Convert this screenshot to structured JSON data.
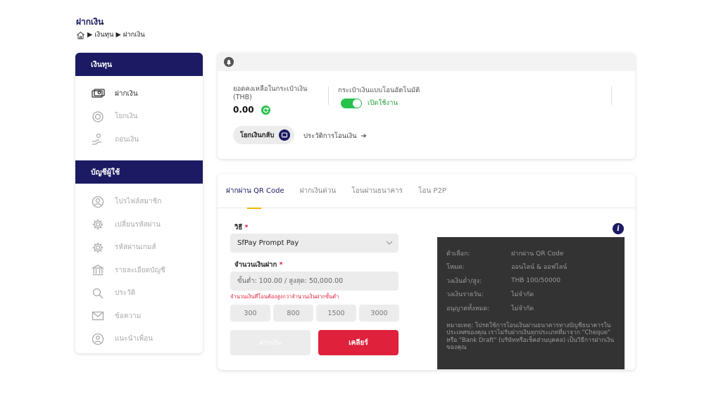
{
  "page": {
    "title": "ฝากเงิน",
    "breadcrumb": [
      "เงินทุน",
      "ฝากเงิน"
    ]
  },
  "sidebar": {
    "section1_title": "เงินทุน",
    "section1_items": [
      {
        "label": "ฝากเงิน",
        "icon": "deposit-icon",
        "active": true
      },
      {
        "label": "โยกเงิน",
        "icon": "transfer-icon",
        "active": false
      },
      {
        "label": "ถอนเงิน",
        "icon": "withdraw-icon",
        "active": false
      }
    ],
    "section2_title": "บัญชีผู้ใช้",
    "section2_items": [
      {
        "label": "โปรไฟล์สมาชิก",
        "icon": "user-icon"
      },
      {
        "label": "เปลี่ยนรหัสผ่าน",
        "icon": "gear-icon"
      },
      {
        "label": "รหัสผ่านเกมส์",
        "icon": "gear-icon"
      },
      {
        "label": "รายละเอียดบัญชี",
        "icon": "bank-icon"
      },
      {
        "label": "ประวัติ",
        "icon": "search-icon"
      },
      {
        "label": "ข้อความ",
        "icon": "mail-icon"
      },
      {
        "label": "แนะนำเพื่อน",
        "icon": "refer-icon"
      }
    ]
  },
  "wallet": {
    "balance_label": "ยอดคงเหลือในกระเป๋าเงิน (THB)",
    "balance_value": "0.00",
    "auto_transfer_label": "กระเป๋าเงินแบบโอนอัตโนมัติ",
    "toggle_status": "เปิดใช้งาน",
    "transfer_back_label": "โยกเงินกลับ",
    "history_label": "ประวัติการโอนเงิน"
  },
  "deposit": {
    "tabs": [
      {
        "label": "ฝากผ่าน QR Code",
        "active": true
      },
      {
        "label": "ฝากเงินด่วน",
        "active": false
      },
      {
        "label": "โอนผ่านธนาคาร",
        "active": false
      },
      {
        "label": "โอน P2P",
        "active": false
      }
    ],
    "method_label": "วิธี",
    "method_value": "SfPay Prompt Pay",
    "amount_label": "จำนวนเงินฝาก",
    "amount_placeholder": "ขั้นต่ำ: 100.00 / สูงสุด: 50,000.00",
    "amount_warning": "จำนวนเงินที่โอนต้องสูงกว่าจำนวนเงินฝากขั้นต่ำ",
    "quick_amounts": [
      "300",
      "800",
      "1500",
      "3000"
    ],
    "deposit_button": "ฝากเงิน",
    "clear_button": "เคลียร์",
    "info": {
      "rows": [
        {
          "k": "ตัวเลือก:",
          "v": "ฝากผ่าน QR Code"
        },
        {
          "k": "โหมด:",
          "v": "ออนไลน์ & ออฟไลน์"
        },
        {
          "k": "วงเงินต่ำ/สูง:",
          "v": "THB 100/50000"
        },
        {
          "k": "วงเงินรายวัน:",
          "v": "ไม่จำกัด"
        },
        {
          "k": "อนุญาตทั้งหมด:",
          "v": "ไม่จำกัด"
        }
      ],
      "note": "หมายเหตุ: โปรดใช้การโอนเงินผ่านธนาคารทางบัญชีธนาคารในประเทศของคุณ เราไม่รับฝากเงินทุกประเภทที่มาจาก \"Cheque\" หรือ \"Bank Draft\" (บริษัทหรือเช็คส่วนบุคคล) เป็นวิธีการฝากเงินของคุณ"
    }
  }
}
